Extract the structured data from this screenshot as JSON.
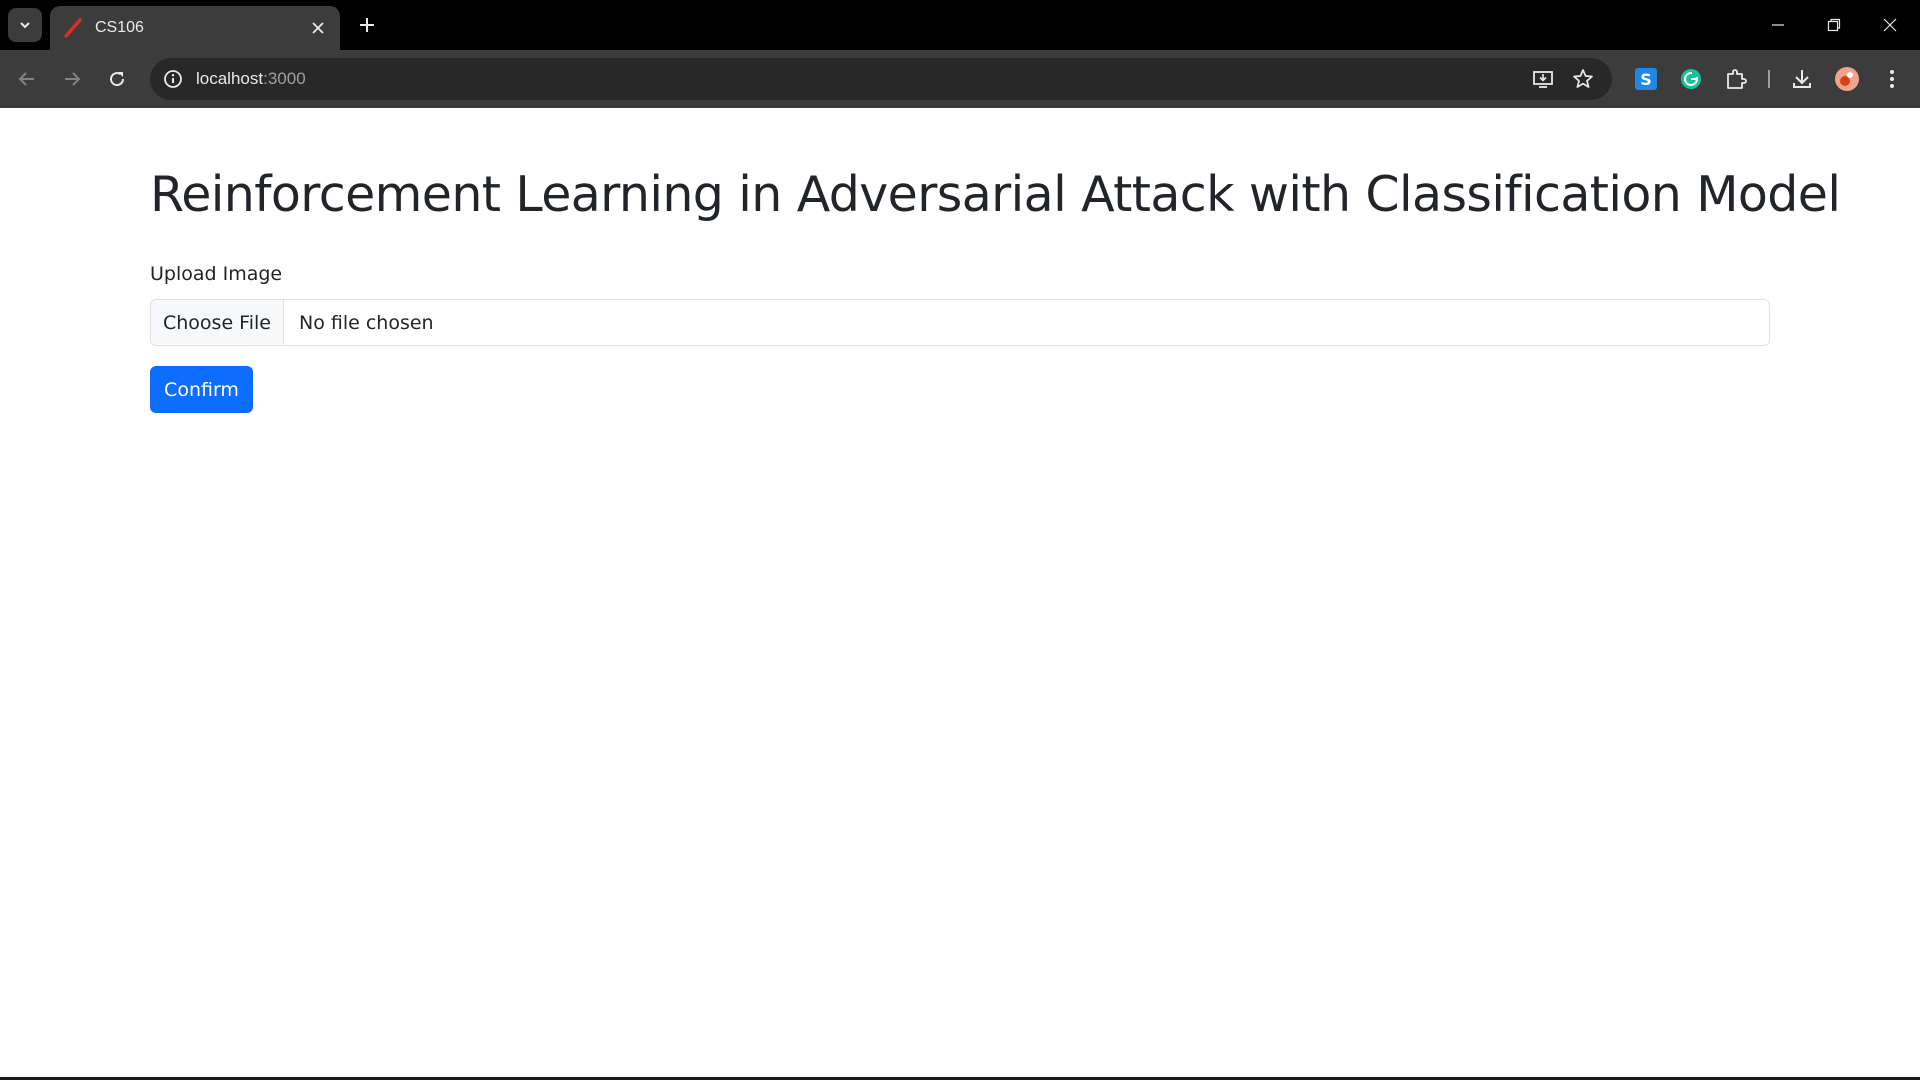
{
  "browser": {
    "tab": {
      "title": "CS106"
    },
    "address": {
      "host": "localhost",
      "port": ":3000"
    },
    "icons": {
      "tab_search": "chevron-down-icon",
      "favicon": "slash-favicon-icon",
      "tab_close": "close-icon",
      "new_tab": "plus-icon",
      "minimize": "minimize-icon",
      "restore": "restore-icon",
      "close_window": "close-icon",
      "back": "back-arrow-icon",
      "forward": "forward-arrow-icon",
      "reload": "reload-icon",
      "site_info": "info-icon",
      "install": "install-app-icon",
      "bookmark": "star-icon",
      "extension_s": "s-extension-icon",
      "grammarly": "grammarly-icon",
      "extensions": "puzzle-icon",
      "downloads": "download-icon",
      "profile": "avatar",
      "menu": "more-vert-icon"
    }
  },
  "page": {
    "title": "Reinforcement Learning in Adversarial Attack with Classification Model",
    "upload_label": "Upload Image",
    "file_button": "Choose File",
    "file_status": "No file chosen",
    "confirm_button": "Confirm"
  },
  "colors": {
    "primary": "#0d6efd",
    "text": "#212529",
    "border": "#dee2e6",
    "browser_dark": "#3c3c3c"
  }
}
